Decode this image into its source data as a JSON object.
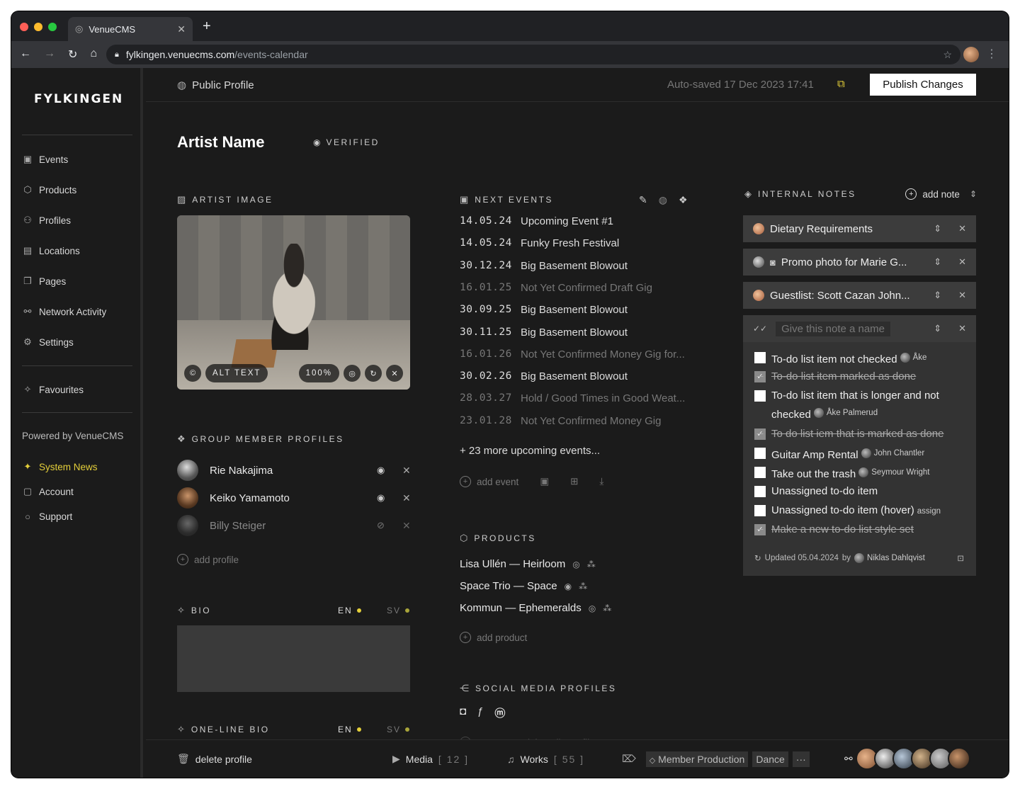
{
  "browser": {
    "tab_title": "VenueCMS",
    "url_host": "fylkingen.venuecms.com",
    "url_path": "/events-calendar"
  },
  "sidebar": {
    "logo": "FYLKINGEN",
    "items": [
      {
        "label": "Events",
        "icon": "calendar-icon"
      },
      {
        "label": "Products",
        "icon": "box-icon"
      },
      {
        "label": "Profiles",
        "icon": "users-icon"
      },
      {
        "label": "Locations",
        "icon": "building-icon"
      },
      {
        "label": "Pages",
        "icon": "pages-icon"
      },
      {
        "label": "Network Activity",
        "icon": "network-icon"
      },
      {
        "label": "Settings",
        "icon": "gear-icon"
      }
    ],
    "favourites": "Favourites",
    "powered_by": "Powered by VenueCMS",
    "system_news": "System News",
    "account": "Account",
    "support": "Support",
    "accent_color": "#e4cf3a"
  },
  "topbar": {
    "title": "Public Profile",
    "autosaved": "Auto-saved 17 Dec 2023 17:41",
    "publish": "Publish Changes"
  },
  "profile": {
    "name": "Artist Name",
    "verified": "VERIFIED"
  },
  "artist_image": {
    "heading": "ARTIST IMAGE",
    "alt_text": "ALT TEXT",
    "zoom": "100%"
  },
  "group_members": {
    "heading": "GROUP MEMBER PROFILES",
    "members": [
      {
        "name": "Rie Nakajima",
        "visible": true
      },
      {
        "name": "Keiko Yamamoto",
        "visible": true
      },
      {
        "name": "Billy Steiger",
        "visible": false
      }
    ],
    "add": "add profile"
  },
  "bio": {
    "heading": "BIO",
    "lang_en": "EN",
    "lang_sv": "SV"
  },
  "one_line_bio": {
    "heading": "ONE-LINE BIO",
    "lang_en": "EN",
    "lang_sv": "SV"
  },
  "events": {
    "heading": "NEXT EVENTS",
    "items": [
      {
        "date": "14.05.24",
        "title": "Upcoming Event #1",
        "confirmed": true
      },
      {
        "date": "14.05.24",
        "title": "Funky Fresh Festival",
        "confirmed": true
      },
      {
        "date": "30.12.24",
        "title": "Big Basement Blowout",
        "confirmed": true
      },
      {
        "date": "16.01.25",
        "title": "Not Yet Confirmed Draft Gig",
        "confirmed": false
      },
      {
        "date": "30.09.25",
        "title": "Big Basement Blowout",
        "confirmed": true
      },
      {
        "date": "30.11.25",
        "title": "Big Basement Blowout",
        "confirmed": true
      },
      {
        "date": "16.01.26",
        "title": "Not Yet Confirmed Money Gig for...",
        "confirmed": false
      },
      {
        "date": "30.02.26",
        "title": "Big Basement Blowout",
        "confirmed": true
      },
      {
        "date": "28.03.27",
        "title": "Hold / Good Times in Good Weat...",
        "confirmed": false
      },
      {
        "date": "23.01.28",
        "title": "Not Yet Confirmed Money Gig",
        "confirmed": false
      }
    ],
    "more": "+ 23 more upcoming events...",
    "add": "add event"
  },
  "products": {
    "heading": "PRODUCTS",
    "items": [
      "Lisa Ullén — Heirloom",
      "Space Trio — Space",
      "Kommun — Ephemeralds"
    ],
    "add": "add product"
  },
  "social": {
    "heading": "SOCIAL MEDIA PROFILES",
    "connect": "connect social media profile"
  },
  "notes": {
    "heading": "INTERNAL NOTES",
    "add": "add note",
    "collapsed": [
      {
        "title": "Dietary Requirements"
      },
      {
        "title": "Promo photo for Marie G..."
      },
      {
        "title": "Guestlist: Scott Cazan John..."
      }
    ],
    "open_placeholder": "Give this note a name",
    "todos": [
      {
        "text": "To-do list item not checked",
        "done": false,
        "assignee": "Åke"
      },
      {
        "text": "To-do list item marked as done",
        "done": true,
        "assignee": ""
      },
      {
        "text": "To-do list item that is longer and not checked",
        "done": false,
        "assignee": "Åke Palmerud"
      },
      {
        "text": "To do list iem that is marked as done",
        "done": true,
        "assignee": ""
      },
      {
        "text": "Guitar Amp Rental",
        "done": false,
        "assignee": "John Chantler"
      },
      {
        "text": "Take out the trash",
        "done": false,
        "assignee": "Seymour Wright"
      },
      {
        "text": "Unassigned to-do item",
        "done": false,
        "assignee": ""
      },
      {
        "text": "Unassigned to-do item (hover)",
        "done": false,
        "assignee": "assign"
      },
      {
        "text": "Make a new to-do list style set",
        "done": true,
        "assignee": ""
      }
    ],
    "updated": "Updated 05.04.2024",
    "by": "by",
    "updated_by": "Niklas Dahlqvist"
  },
  "bottom": {
    "delete": "delete profile",
    "media": "Media",
    "media_count": "[ 12 ]",
    "works": "Works",
    "works_count": "[ 55 ]",
    "tag1": "Member Production",
    "tag2": "Dance",
    "more": "···"
  }
}
